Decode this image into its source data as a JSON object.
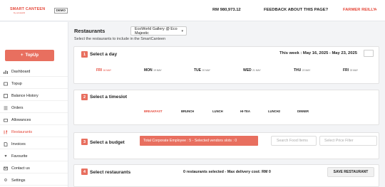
{
  "header": {
    "logo_text": "SMART CANTEEN",
    "logo_subtext": "by ecoworld",
    "demo_badge": "DEMO",
    "balance": "RM 980,973.12",
    "feedback_link": "FEEDBACK ABOUT THIS PAGE?",
    "username": "FARMER REILLY",
    "user_icon": "chevron-down-icon"
  },
  "sidebar": {
    "topup_button": "TopUp",
    "topup_icon": "plus-icon",
    "items": [
      {
        "label": "Dashboard",
        "icon": "bar-chart-icon",
        "active": false
      },
      {
        "label": "Topup",
        "icon": "wallet-icon",
        "active": false
      },
      {
        "label": "Balance History",
        "icon": "history-icon",
        "active": false
      },
      {
        "label": "Orders",
        "icon": "orders-icon",
        "active": false
      },
      {
        "label": "Allowances",
        "icon": "allowance-icon",
        "active": false
      },
      {
        "label": "Restaurants",
        "icon": "restaurant-icon",
        "active": true
      },
      {
        "label": "Invoices",
        "icon": "invoice-icon",
        "active": false
      },
      {
        "label": "Favourite",
        "icon": "heart-icon",
        "active": false
      },
      {
        "label": "Contact us",
        "icon": "mail-icon",
        "active": false
      },
      {
        "label": "Settings",
        "icon": "gear-icon",
        "active": false
      }
    ]
  },
  "main": {
    "page_title": "Restaurants",
    "restaurant_select": "EcoWorld Gallery @ Eco Majestic",
    "subtitle": "Select the restaurants to include in the SmartCanteen",
    "accent_color": "#e86f5f",
    "step1": {
      "number": "1",
      "title": "Select a day",
      "week_label": "This week : May 16, 2025 - May 23, 2025",
      "days": [
        {
          "name": "FRI",
          "date": "16 MAY",
          "selected": true
        },
        {
          "name": "MON",
          "date": "19 MAY",
          "selected": false
        },
        {
          "name": "TUE",
          "date": "20 MAY",
          "selected": false
        },
        {
          "name": "WED",
          "date": "21 MAY",
          "selected": false
        },
        {
          "name": "THU",
          "date": "22 MAY",
          "selected": false
        },
        {
          "name": "FRI",
          "date": "23 MAY",
          "selected": false
        }
      ]
    },
    "step2": {
      "number": "2",
      "title": "Select a timeslot",
      "slots": [
        {
          "label": "BREAKFAST",
          "selected": true
        },
        {
          "label": "BRUNCH",
          "selected": false
        },
        {
          "label": "LUNCH",
          "selected": false
        },
        {
          "label": "HI-TEA",
          "selected": false
        },
        {
          "label": "LUNCH2",
          "selected": false
        },
        {
          "label": "DINNER",
          "selected": false
        }
      ]
    },
    "step3": {
      "number": "3",
      "title": "Select a budget",
      "budget_badge": "Total Corporate Employee : 5 - Selected vendors slots : 0",
      "search_placeholder": "Search Food Items",
      "price_filter": "Select Price Filter"
    },
    "step4": {
      "number": "4",
      "title": "Select restaurants",
      "selected_info": "0 restaurants selected - Max delivery cost: RM 0",
      "save_button": "SAVE RESTAURANT"
    }
  }
}
